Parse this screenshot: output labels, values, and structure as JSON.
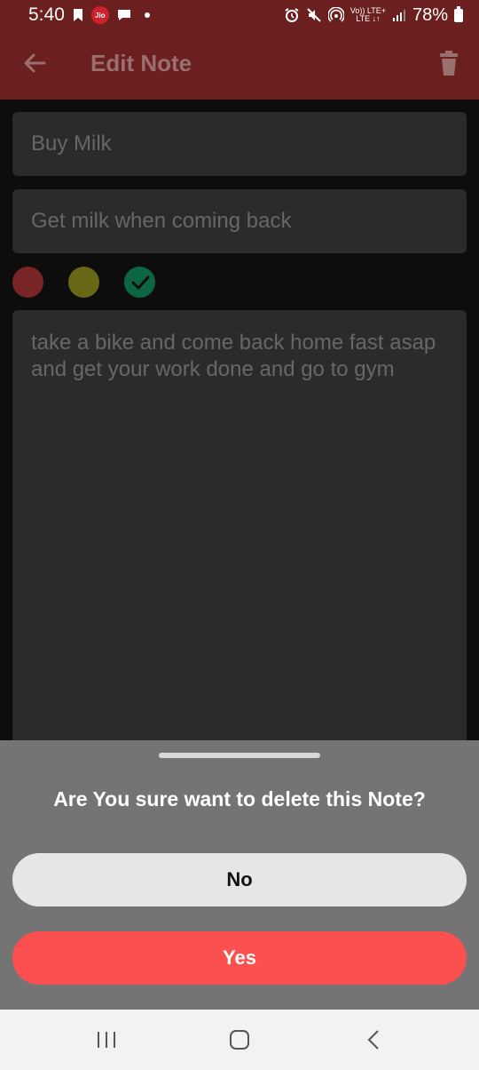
{
  "status_bar": {
    "time": "5:40",
    "jio_label": "Jio",
    "network_top": "Vo)) LTE+",
    "network_bottom": "LTE ↓↑",
    "battery": "78%"
  },
  "app_bar": {
    "title": "Edit Note"
  },
  "note": {
    "title_value": "Buy Milk",
    "description_value": "Get milk when coming back",
    "body_value": "take a bike and come back home fast asap and get your work done and go to gym"
  },
  "color_options": [
    {
      "name": "red",
      "color": "#a33232",
      "selected": false
    },
    {
      "name": "yellow",
      "color": "#8a8a1c",
      "selected": false
    },
    {
      "name": "green",
      "color": "#0f8a5a",
      "selected": true
    }
  ],
  "dialog": {
    "message": "Are You sure want to delete this Note?",
    "no_label": "No",
    "yes_label": "Yes"
  },
  "colors": {
    "app_bar": "#6b1f1f",
    "yes_button": "#fa5050",
    "no_button": "#e6e6e6",
    "sheet": "#747474"
  }
}
